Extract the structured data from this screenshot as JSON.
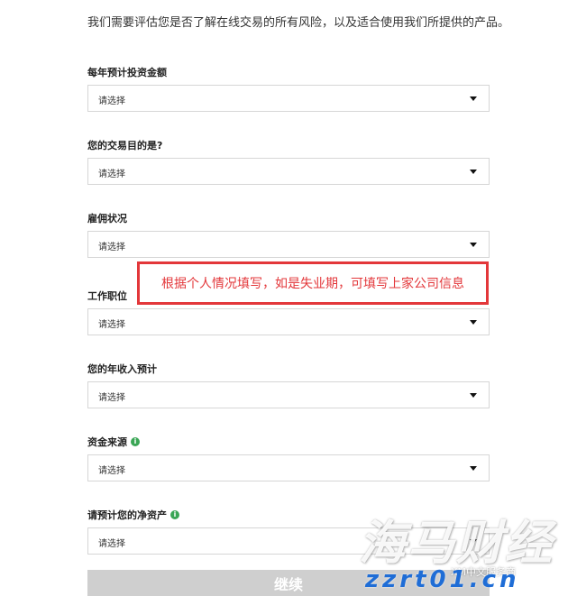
{
  "intro": "我们需要评估您是否了解在线交易的所有风险，以及适合使用我们所提供的产品。",
  "fields": [
    {
      "label": "每年预计投资金额",
      "value": "请选择",
      "info": false
    },
    {
      "label": "您的交易目的是?",
      "value": "请选择",
      "info": false
    },
    {
      "label": "雇佣状况",
      "value": "请选择",
      "info": false
    },
    {
      "label": "工作职位",
      "value": "请选择",
      "info": false
    },
    {
      "label": "您的年收入预计",
      "value": "请选择",
      "info": false
    },
    {
      "label": "资金来源",
      "value": "请选择",
      "info": true
    },
    {
      "label": "请预计您的净资产",
      "value": "请选择",
      "info": true
    }
  ],
  "callout": "根据个人情况填写，如是失业期，可填写上家公司信息",
  "continue_label": "继续",
  "watermark": {
    "brand": "海马财经",
    "account": "XM中文服务商",
    "url": "zzrt01.cn"
  },
  "colors": {
    "callout": "#e3373a",
    "button_disabled": "#cfcfcf",
    "info": "#3aa655",
    "watermark_url": "#1f6dd6"
  }
}
